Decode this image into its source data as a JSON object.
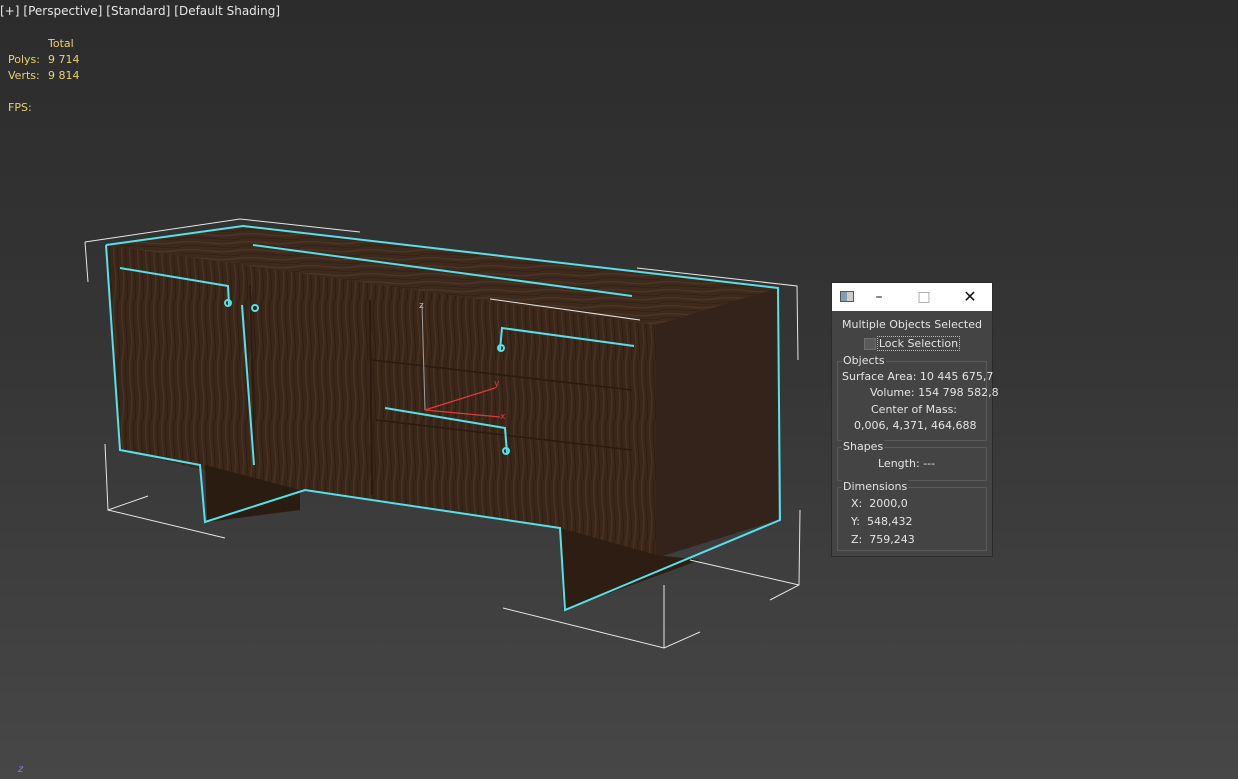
{
  "viewport": {
    "labels": [
      "[+]",
      "[Perspective]",
      "[Standard]",
      "[Default Shading]"
    ]
  },
  "stats": {
    "header": "Total",
    "polys_label": "Polys:",
    "polys_value": "9 714",
    "verts_label": "Verts:",
    "verts_value": "9 814",
    "fps_label": "FPS:"
  },
  "gizmo": {
    "x": "x",
    "y": "y",
    "z": "z"
  },
  "corner_axis": "z",
  "colors": {
    "selection": "#56e0e8",
    "wood": "#3e2a1a",
    "bbox": "#e8e8e8",
    "stats_text": "#e8d36a"
  },
  "dialog": {
    "title": "Multiple Objects Selected",
    "lock_label": "Lock Selection",
    "objects": {
      "group_title": "Objects",
      "surface_area_label": "Surface Area:",
      "surface_area_value": "10 445 675,7",
      "volume_label": "Volume:",
      "volume_value": "154 798 582,8",
      "center_label": "Center of Mass:",
      "center_value": "0,006, 4,371, 464,688"
    },
    "shapes": {
      "group_title": "Shapes",
      "length_label": "Length:",
      "length_value": "---"
    },
    "dimensions": {
      "group_title": "Dimensions",
      "x_label": "X:",
      "x_value": "2000,0",
      "y_label": "Y:",
      "y_value": "548,432",
      "z_label": "Z:",
      "z_value": "759,243"
    }
  }
}
